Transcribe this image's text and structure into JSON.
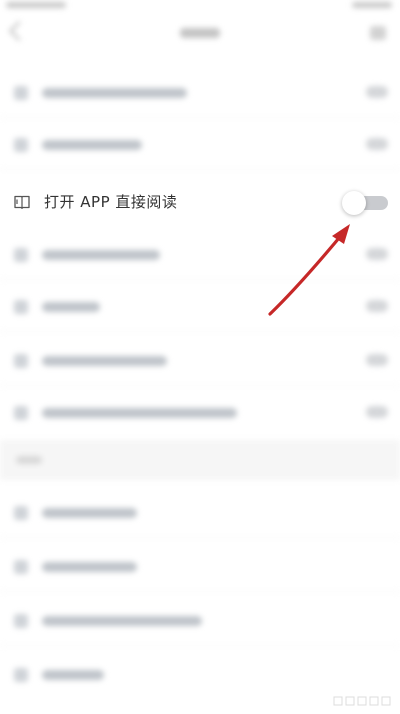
{
  "settings": {
    "open_app_read": {
      "label": "打开 APP 直接阅读",
      "icon": "book-icon",
      "enabled": false
    }
  },
  "colors": {
    "label_text": "#333333",
    "toggle_track_off": "#c9cbcf",
    "toggle_knob": "#ffffff",
    "annotation_arrow": "#c62828",
    "background": "#ffffff"
  },
  "annotation": {
    "icon": "arrow-pointer",
    "target": "open-app-read-toggle"
  }
}
